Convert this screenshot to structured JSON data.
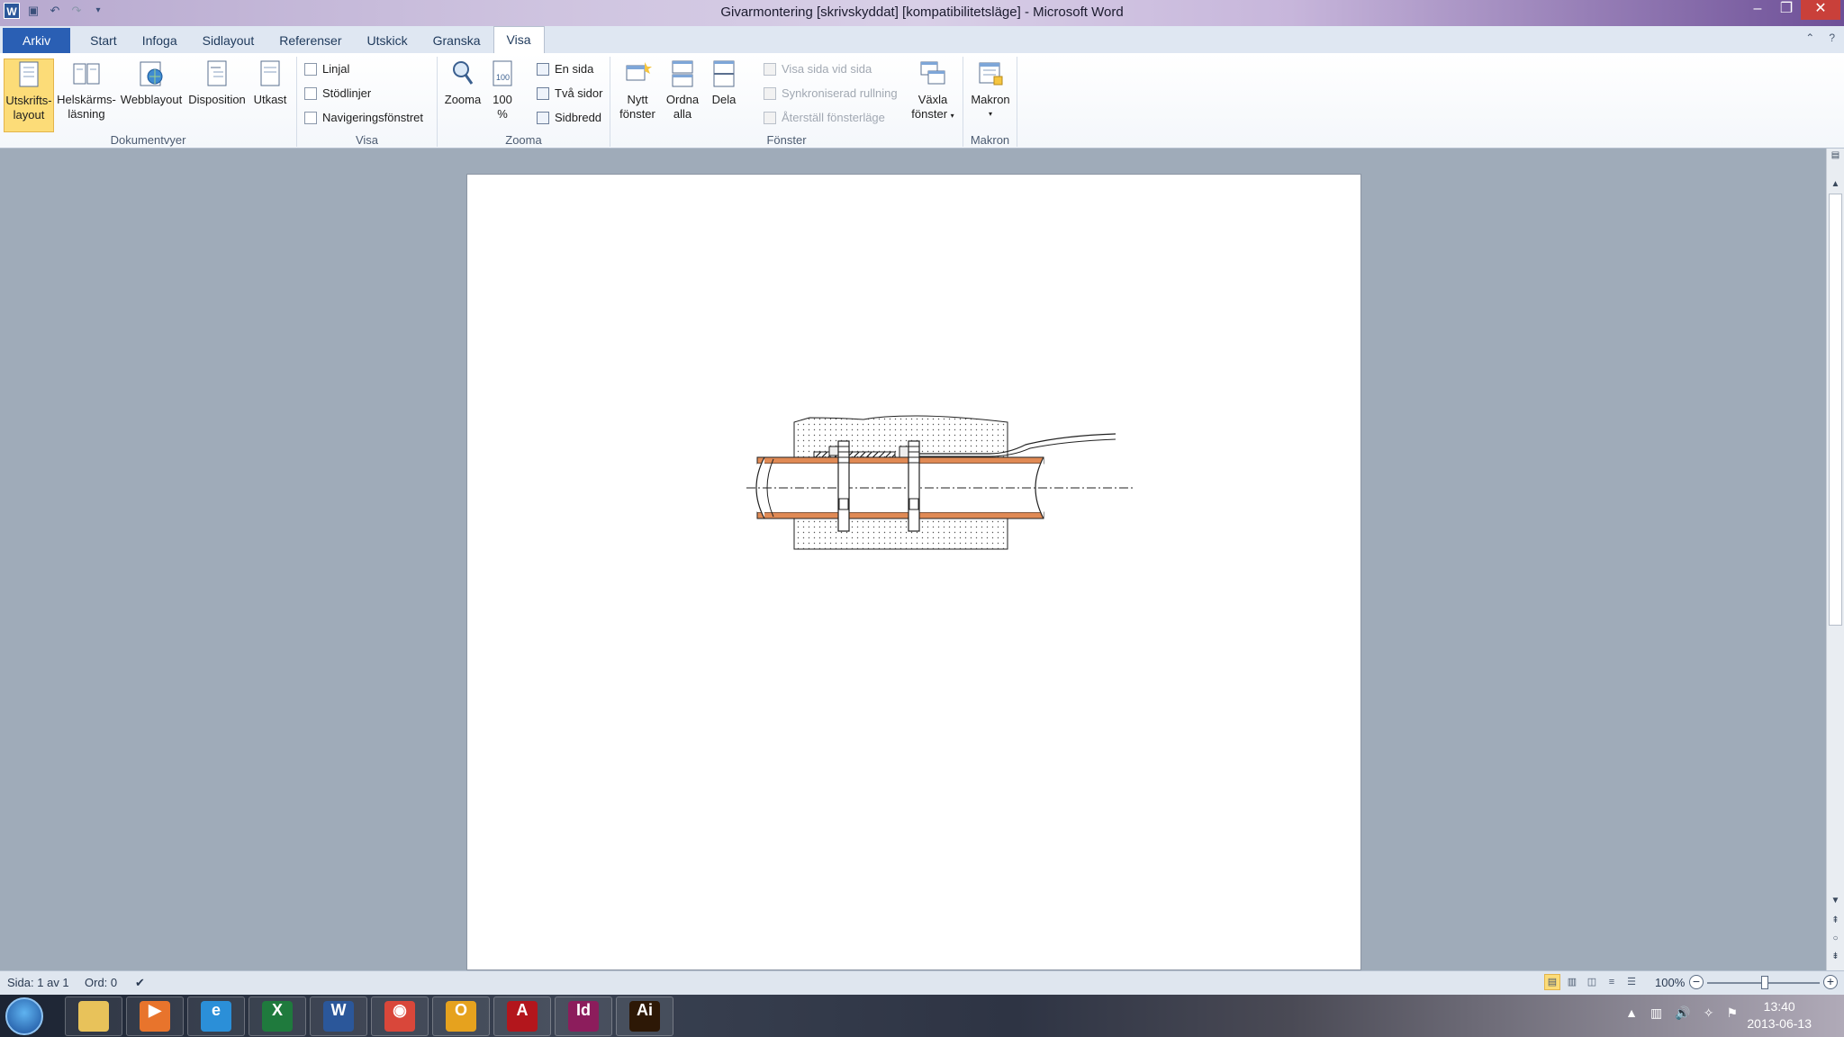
{
  "window": {
    "title": "Givarmontering [skrivskyddat] [kompatibilitetsläge] - Microsoft Word",
    "app_icon_letter": "W"
  },
  "tabs": [
    "Arkiv",
    "Start",
    "Infoga",
    "Sidlayout",
    "Referenser",
    "Utskick",
    "Granska",
    "Visa"
  ],
  "active_tab": "Visa",
  "ribbon": {
    "dokumentvyer": {
      "label": "Dokumentvyer",
      "buttons": [
        {
          "line1": "Utskrifts-",
          "line2": "layout"
        },
        {
          "line1": "Helskärms-",
          "line2": "läsning"
        },
        {
          "line1": "Webblayout",
          "line2": ""
        },
        {
          "line1": "Disposition",
          "line2": ""
        },
        {
          "line1": "Utkast",
          "line2": ""
        }
      ]
    },
    "visa": {
      "label": "Visa",
      "checkboxes": [
        "Linjal",
        "Stödlinjer",
        "Navigeringsfönstret"
      ]
    },
    "zooma": {
      "label": "Zooma",
      "zoom_label": "Zooma",
      "hundred_line1": "100",
      "hundred_line2": "%",
      "small": [
        "En sida",
        "Två sidor",
        "Sidbredd"
      ]
    },
    "fonster": {
      "label": "Fönster",
      "nytt_line1": "Nytt",
      "nytt_line2": "fönster",
      "ordna_line1": "Ordna",
      "ordna_line2": "alla",
      "dela": "Dela",
      "small": [
        "Visa sida vid sida",
        "Synkroniserad rullning",
        "Återställ fönsterläge"
      ],
      "vaxla_line1": "Växla",
      "vaxla_line2": "fönster"
    },
    "makron": {
      "label": "Makron",
      "button": "Makron"
    }
  },
  "statusbar": {
    "page": "Sida: 1 av 1",
    "words": "Ord: 0",
    "zoom": "100%"
  },
  "taskbar": {
    "apps": [
      {
        "name": "explorer",
        "glyph": "",
        "color": "#e8c25a"
      },
      {
        "name": "media-player",
        "glyph": "▶",
        "color": "#e8742c"
      },
      {
        "name": "internet-explorer",
        "glyph": "e",
        "color": "#2b8fd8"
      },
      {
        "name": "excel",
        "glyph": "X",
        "color": "#1f7a3d"
      },
      {
        "name": "word",
        "glyph": "W",
        "color": "#2b579a"
      },
      {
        "name": "chrome",
        "glyph": "◉",
        "color": "#d9473a"
      },
      {
        "name": "outlook",
        "glyph": "O",
        "color": "#e6a21e"
      },
      {
        "name": "acrobat",
        "glyph": "A",
        "color": "#b3161c"
      },
      {
        "name": "indesign",
        "glyph": "Id",
        "color": "#8c1d5c"
      },
      {
        "name": "illustrator",
        "glyph": "Ai",
        "color": "#2d1806"
      }
    ],
    "time": "13:40",
    "date": "2013-06-13"
  },
  "colors": {
    "file_tab": "#2a5fb4",
    "selected_button": "#fcdc78",
    "pipe_copper": "#e08a55"
  }
}
